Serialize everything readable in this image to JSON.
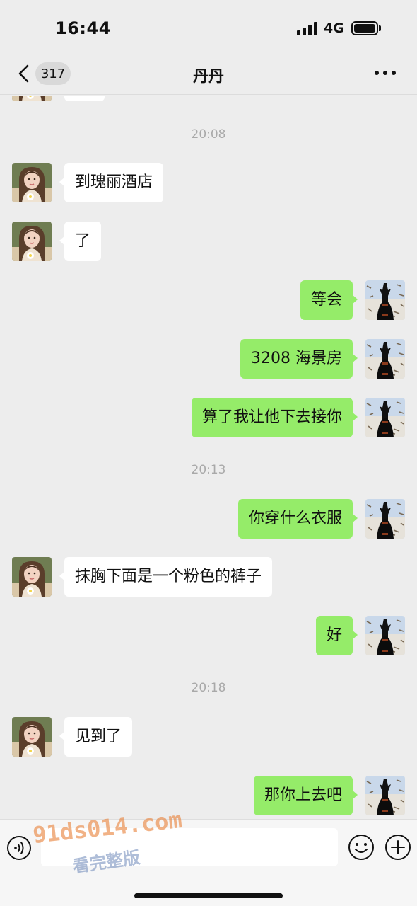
{
  "status": {
    "time": "16:44",
    "network": "4G"
  },
  "nav": {
    "unread_count": "317",
    "title": "丹丹"
  },
  "messages": {
    "t1": "20:08",
    "m1": "到瑰丽酒店",
    "m2": "了",
    "m3": "等会",
    "m4": "3208 海景房",
    "m5": "算了我让他下去接你",
    "t2": "20:13",
    "m6": "你穿什么衣服",
    "m7": "抹胸下面是一个粉色的裤子",
    "m8": "好",
    "t3": "20:18",
    "m9": "见到了",
    "m10": "那你上去吧"
  },
  "watermark": {
    "domain": "91ds014.com",
    "tag": "看完整版"
  },
  "colors": {
    "background": "#ededed",
    "outgoing_bubble": "#95ec69",
    "incoming_bubble": "#ffffff",
    "timestamp": "#a9a9a9"
  },
  "icons": {
    "back": "chevron-left-icon",
    "more": "more-dots-icon",
    "voice": "voice-icon",
    "emoji": "emoji-icon",
    "plus": "plus-icon"
  }
}
